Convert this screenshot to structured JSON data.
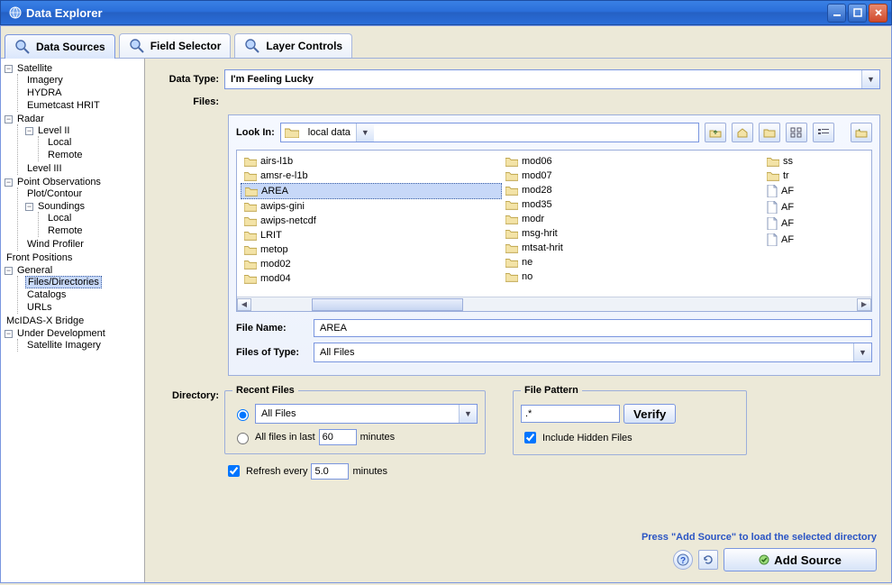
{
  "window": {
    "title": "Data Explorer"
  },
  "tabs": [
    {
      "label": "Data Sources"
    },
    {
      "label": "Field Selector"
    },
    {
      "label": "Layer Controls"
    }
  ],
  "tree": {
    "satellite": "Satellite",
    "sat_imagery": "Imagery",
    "sat_hydra": "HYDRA",
    "sat_eumet": "Eumetcast HRIT",
    "radar": "Radar",
    "radar_l2": "Level II",
    "radar_l2_local": "Local",
    "radar_l2_remote": "Remote",
    "radar_l3": "Level III",
    "ptobs": "Point Observations",
    "pt_plot": "Plot/Contour",
    "pt_snd": "Soundings",
    "pt_snd_local": "Local",
    "pt_snd_remote": "Remote",
    "pt_wind": "Wind Profiler",
    "front": "Front Positions",
    "general": "General",
    "gen_files": "Files/Directories",
    "gen_cat": "Catalogs",
    "gen_url": "URLs",
    "mcx": "McIDAS-X Bridge",
    "underdev": "Under Development",
    "ud_sat": "Satellite Imagery"
  },
  "form": {
    "data_type_label": "Data Type:",
    "data_type_value": "I'm Feeling Lucky",
    "files_label": "Files:",
    "look_in_label": "Look In:",
    "look_in_value": "local data",
    "file_name_label": "File Name:",
    "file_name_value": "AREA",
    "files_of_type_label": "Files of Type:",
    "files_of_type_value": "All Files",
    "directory_label": "Directory:"
  },
  "filelist": [
    {
      "name": "airs-l1b",
      "type": "folder"
    },
    {
      "name": "amsr-e-l1b",
      "type": "folder"
    },
    {
      "name": "AREA",
      "type": "folder",
      "selected": true
    },
    {
      "name": "awips-gini",
      "type": "folder"
    },
    {
      "name": "awips-netcdf",
      "type": "folder"
    },
    {
      "name": "LRIT",
      "type": "folder"
    },
    {
      "name": "metop",
      "type": "folder"
    },
    {
      "name": "mod02",
      "type": "folder"
    },
    {
      "name": "mod04",
      "type": "folder"
    },
    {
      "name": "mod06",
      "type": "folder"
    },
    {
      "name": "mod07",
      "type": "folder"
    },
    {
      "name": "mod28",
      "type": "folder"
    },
    {
      "name": "mod35",
      "type": "folder"
    },
    {
      "name": "modr",
      "type": "folder"
    },
    {
      "name": "msg-hrit",
      "type": "folder"
    },
    {
      "name": "mtsat-hrit",
      "type": "folder"
    },
    {
      "name": "ne",
      "type": "folder"
    },
    {
      "name": "no",
      "type": "folder"
    },
    {
      "name": "ss",
      "type": "folder"
    },
    {
      "name": "tr",
      "type": "folder"
    },
    {
      "name": "AF",
      "type": "file"
    },
    {
      "name": "AF",
      "type": "file"
    },
    {
      "name": "AF",
      "type": "file"
    },
    {
      "name": "AF",
      "type": "file"
    }
  ],
  "recent": {
    "legend": "Recent Files",
    "all_files": "All Files",
    "all_in_last": "All files in last",
    "minutes1": "minutes",
    "last_val": "60",
    "refresh": "Refresh every",
    "refresh_val": "5.0",
    "minutes2": "minutes"
  },
  "pattern": {
    "legend": "File Pattern",
    "value": ".*",
    "verify": "Verify",
    "include_hidden": "Include Hidden Files"
  },
  "footer": {
    "hint": "Press \"Add Source\" to load the selected directory",
    "add_source": "Add Source"
  }
}
